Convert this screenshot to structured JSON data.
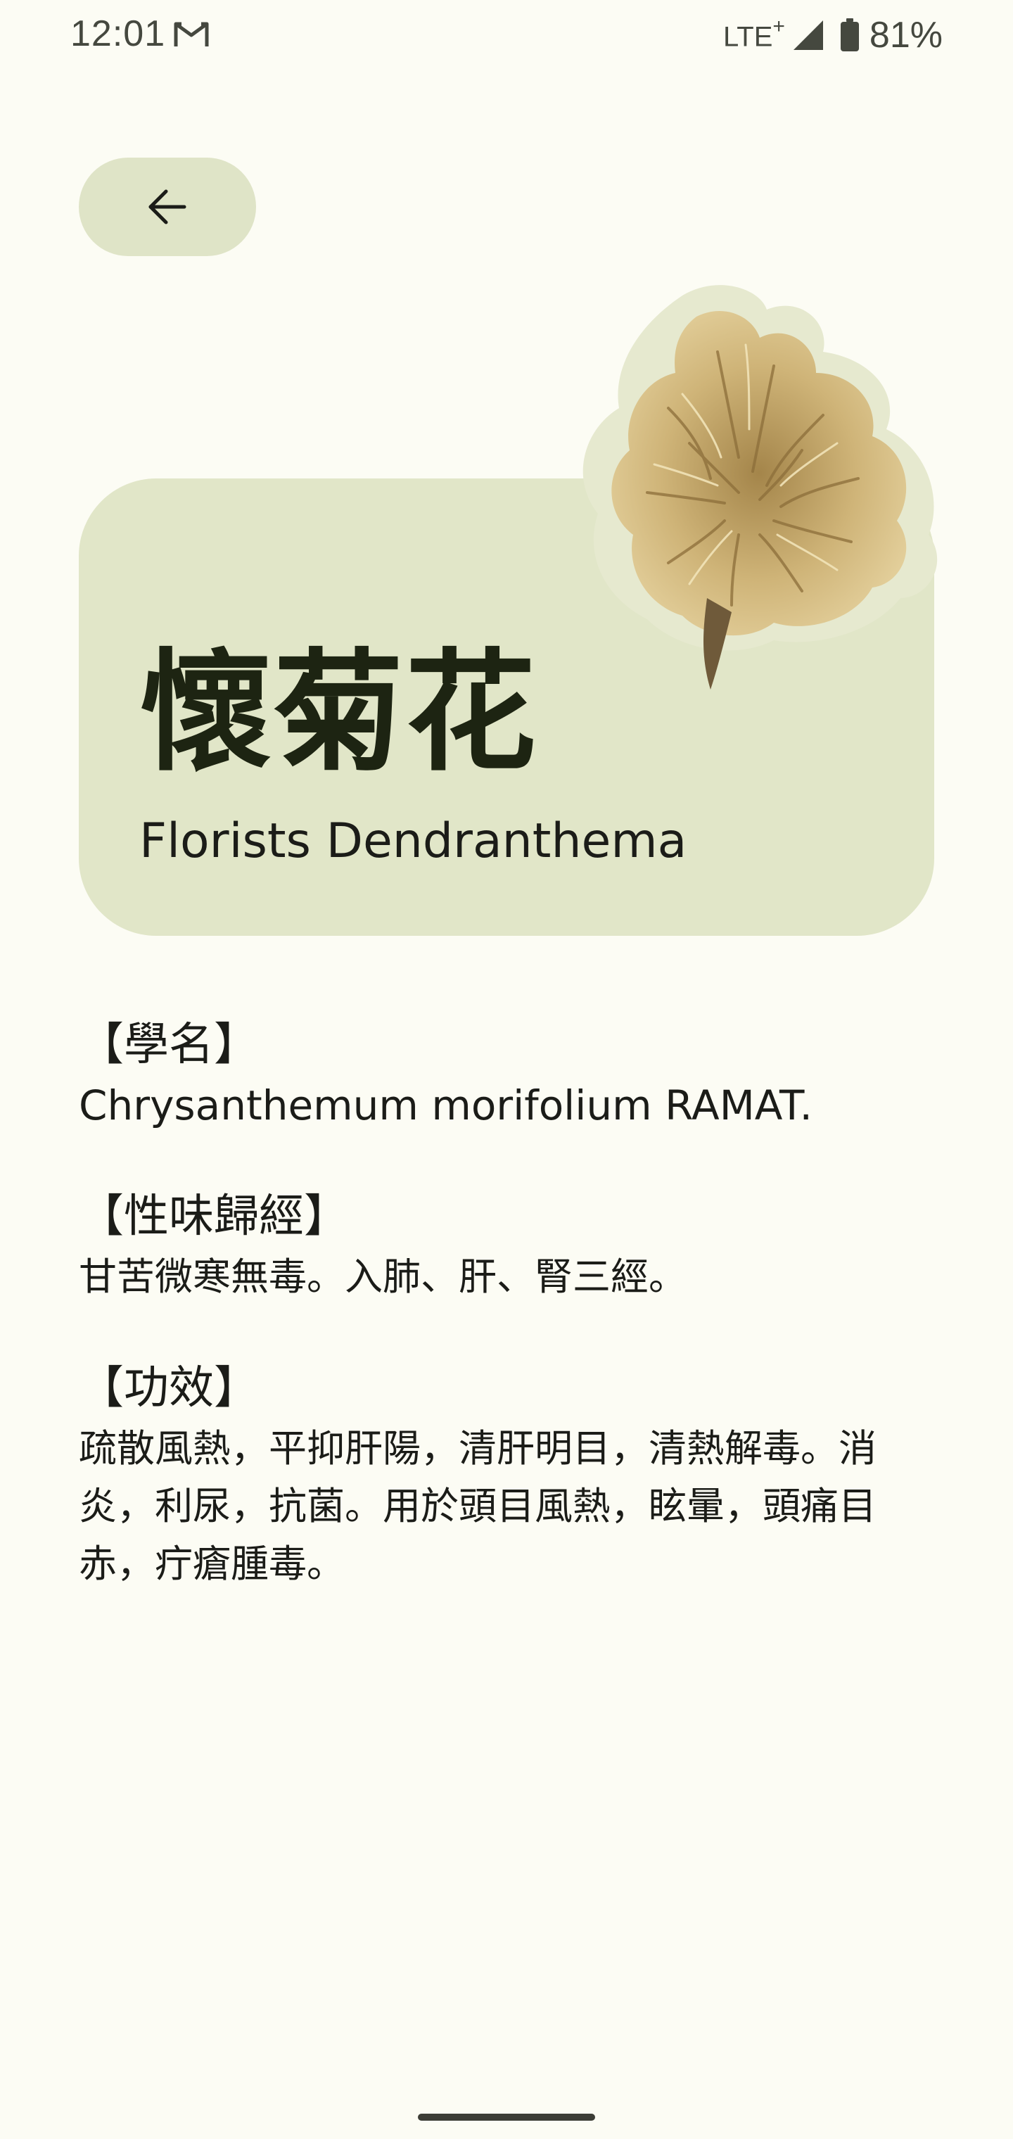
{
  "status_bar": {
    "time": "12:01",
    "network": "LTE",
    "network_plus": "+",
    "battery": "81%",
    "icons": [
      "gmail-icon",
      "signal-icon",
      "battery-icon"
    ]
  },
  "back_button": {
    "icon": "arrow-back-icon"
  },
  "herb": {
    "name_zh": "懷菊花",
    "name_en": "Florists Dendranthema",
    "image": "dried-chrysanthemum-flower"
  },
  "sections": [
    {
      "title": "【學名】",
      "body": "Chrysanthemum morifolium RAMAT."
    },
    {
      "title": "【性味歸經】",
      "body": "甘苦微寒無毒。入肺、肝、腎三經。"
    },
    {
      "title": "【功效】",
      "body_lines": [
        "疏散風熱，平抑肝陽，清肝明目，清熱解毒。消",
        "炎，利尿，抗菌。用於頭目風熱，眩暈，頭痛目",
        "赤，疔瘡腫毒。"
      ]
    }
  ],
  "colors": {
    "background": "#fcfcf4",
    "card": "#e1e6c8",
    "back_button": "#dfe4c7",
    "title_text": "#1d2412",
    "body_text": "#1b1c18"
  }
}
